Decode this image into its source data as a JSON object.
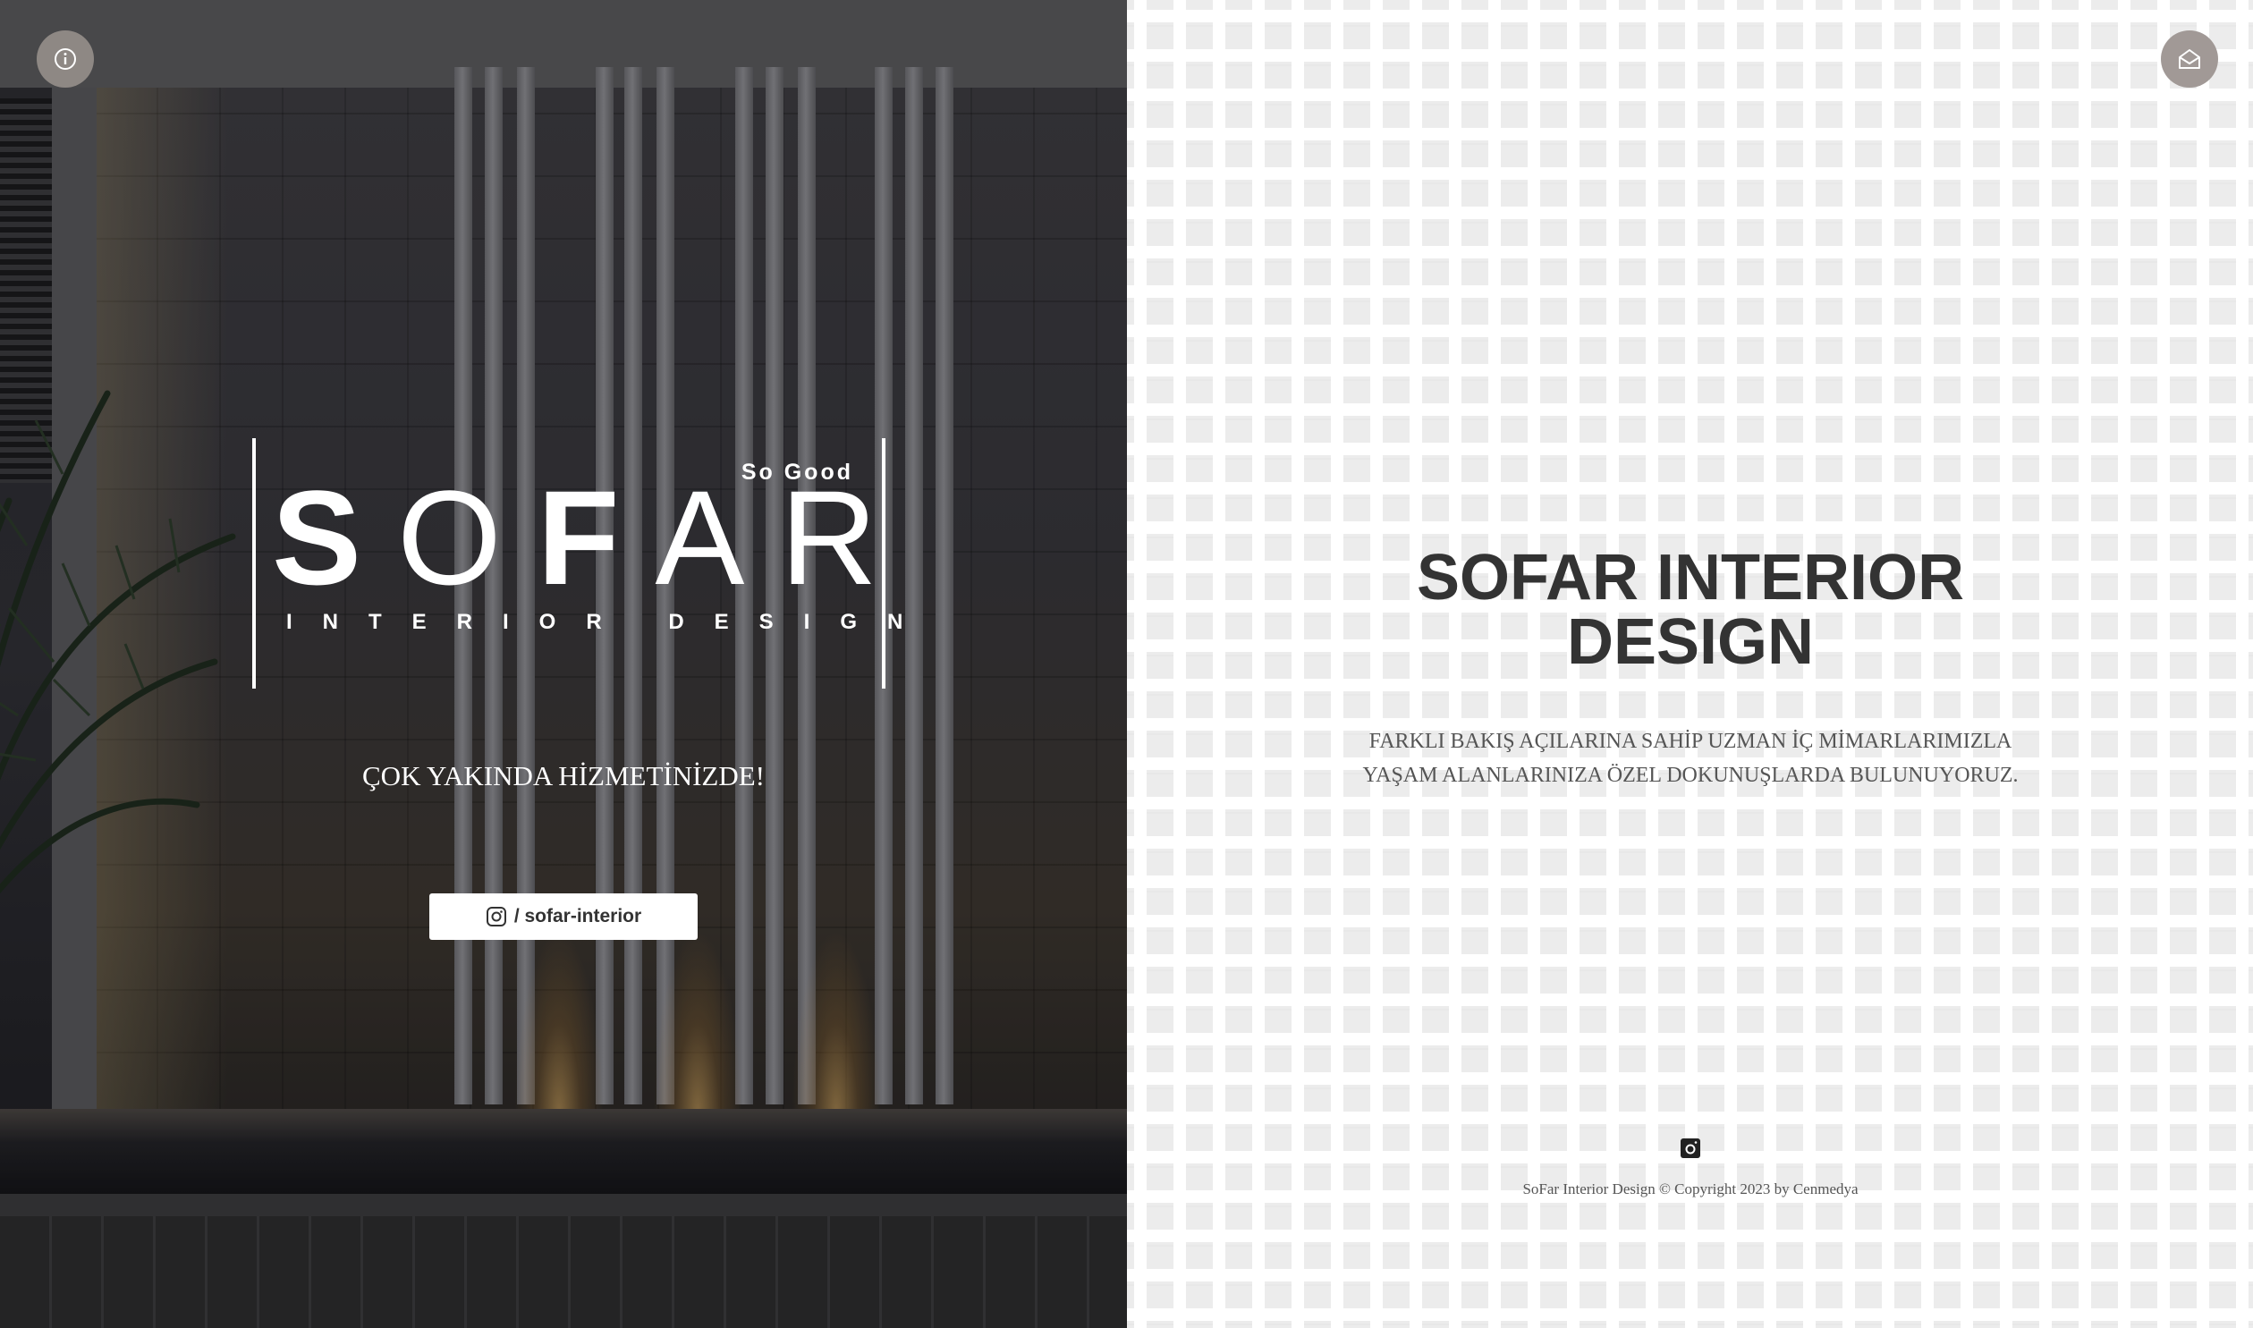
{
  "left_panel": {
    "logo": {
      "tagline": "So Good",
      "brand_bold_1": "S",
      "brand_thin_1": "O",
      "brand_bold_2": "F",
      "brand_thin_2": "AR",
      "subtitle": "INTERIOR DESIGN"
    },
    "coming_soon": "ÇOK YAKINDA HİZMETİNİZDE!",
    "instagram_button_label": "/ sofar-interior",
    "info_icon": "info-icon",
    "home_icon": "home-icon"
  },
  "right_panel": {
    "heading_line1": "SOFAR INTERIOR",
    "heading_line2": "DESIGN",
    "description_line1": "FARKLI BAKIŞ AÇILARINA SAHİP UZMAN İÇ MİMARLARIMIZLA",
    "description_line2": "YAŞAM ALANLARINIZA ÖZEL DOKUNUŞLARDA BULUNUYORUZ.",
    "footer_icon": "instagram-icon",
    "copyright": "SoFar Interior Design © Copyright 2023 by Cenmedya"
  },
  "colors": {
    "heading": "#333333",
    "button_bg": "#ffffff",
    "circle_button": "#8e8884"
  }
}
